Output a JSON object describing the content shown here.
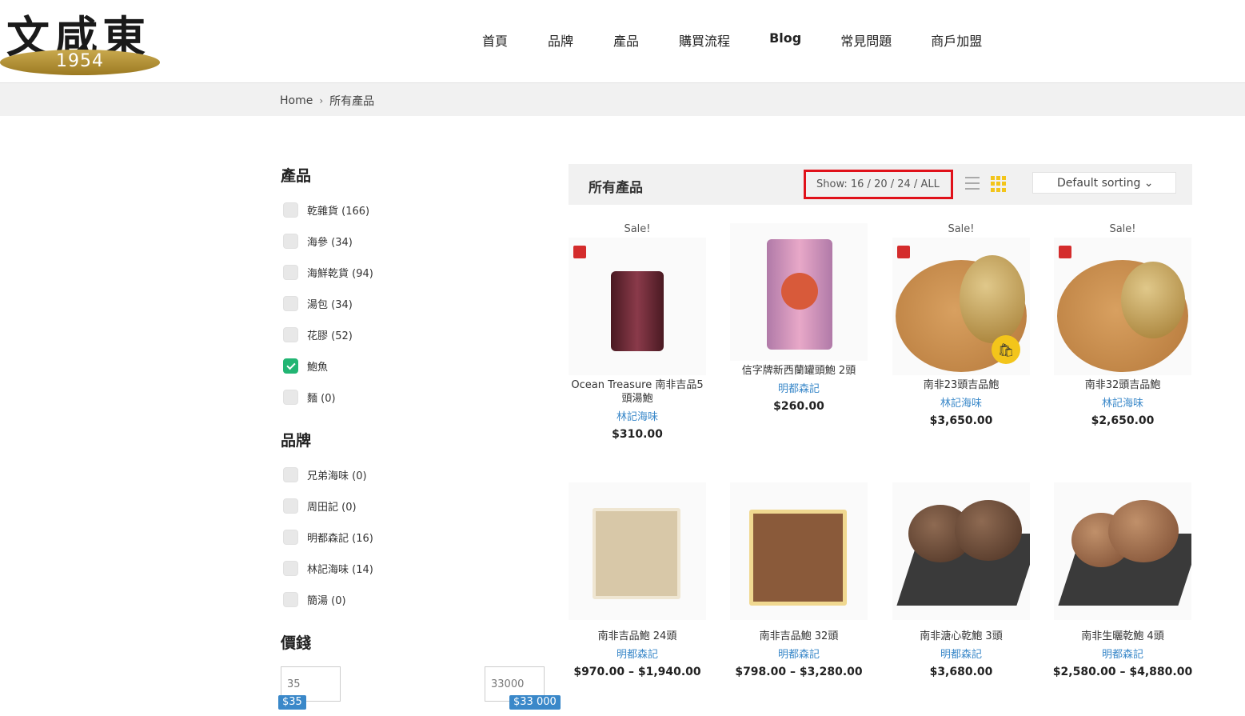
{
  "logo": {
    "chars": "文咸東",
    "year": "1954"
  },
  "nav": [
    "首頁",
    "品牌",
    "產品",
    "購買流程",
    "Blog",
    "常見問題",
    "商戶加盟"
  ],
  "breadcrumb": {
    "home": "Home",
    "sep": "›",
    "current": "所有產品"
  },
  "filters": {
    "categories_title": "產品",
    "categories": [
      {
        "label": "乾雜貨 (166)",
        "checked": false
      },
      {
        "label": "海參 (34)",
        "checked": false
      },
      {
        "label": "海鮮乾貨 (94)",
        "checked": false
      },
      {
        "label": "湯包 (34)",
        "checked": false
      },
      {
        "label": "花膠 (52)",
        "checked": false
      },
      {
        "label": "鮑魚",
        "checked": true
      },
      {
        "label": "麵 (0)",
        "checked": false
      }
    ],
    "brands_title": "品牌",
    "brands": [
      {
        "label": "兄弟海味 (0)"
      },
      {
        "label": "周田記 (0)"
      },
      {
        "label": "明都森記 (16)"
      },
      {
        "label": "林記海味 (14)"
      },
      {
        "label": "簡湯 (0)"
      }
    ],
    "price_title": "價錢",
    "price_min": "35",
    "price_max": "33000",
    "price_min_tag": "$35",
    "price_max_tag": "$33 000"
  },
  "toolbar": {
    "title": "所有產品",
    "show": "Show: 16 / 20 / 24 / ALL",
    "sort": "Default sorting ⌄"
  },
  "products": [
    {
      "sale": "Sale!",
      "name": "Ocean Treasure 南非吉品5頭湯鮑",
      "brand": "林記海味",
      "price": "$310.00"
    },
    {
      "sale": "",
      "name": "信字牌新西蘭罐頭鮑 2頭",
      "brand": "明都森記",
      "price": "$260.00"
    },
    {
      "sale": "Sale!",
      "name": "南非23頭吉品鮑",
      "brand": "林記海味",
      "price": "$3,650.00"
    },
    {
      "sale": "Sale!",
      "name": "南非32頭吉品鮑",
      "brand": "林記海味",
      "price": "$2,650.00"
    },
    {
      "sale": "",
      "name": "南非吉品鮑 24頭",
      "brand": "明都森記",
      "price": "$970.00 – $1,940.00"
    },
    {
      "sale": "",
      "name": "南非吉品鮑 32頭",
      "brand": "明都森記",
      "price": "$798.00 – $3,280.00"
    },
    {
      "sale": "",
      "name": "南非溏心乾鮑 3頭",
      "brand": "明都森記",
      "price": "$3,680.00"
    },
    {
      "sale": "",
      "name": "南非生曬乾鮑 4頭",
      "brand": "明都森記",
      "price": "$2,580.00 – $4,880.00"
    }
  ],
  "colors": {
    "accent": "#f3c51b",
    "link": "#3a88c9",
    "check": "#22b573",
    "highlight": "#e0111a"
  }
}
